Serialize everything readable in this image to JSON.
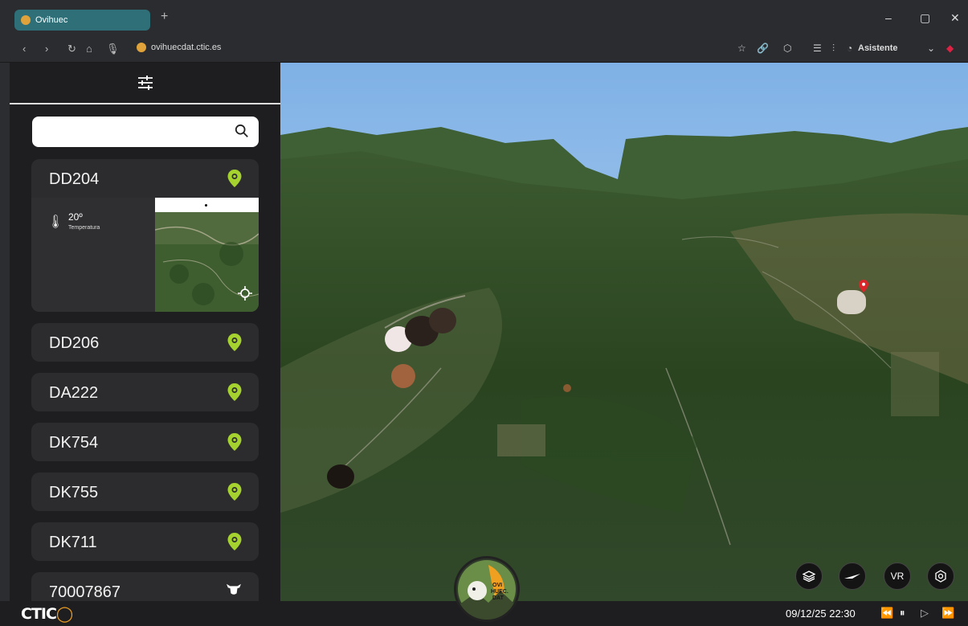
{
  "browser": {
    "tab_title": "Ovihuec",
    "new_tab": "+",
    "url": "ovihuecdat.ctic.es",
    "assistant_label": "Asistente"
  },
  "sidebar": {
    "search_placeholder": "",
    "animals": [
      {
        "id": "DD204",
        "icon": "location-pin-icon",
        "expanded": true,
        "temperature_value": "20º",
        "temperature_label": "Temperatura"
      },
      {
        "id": "DD206",
        "icon": "location-pin-icon"
      },
      {
        "id": "DA222",
        "icon": "location-pin-icon"
      },
      {
        "id": "DK754",
        "icon": "location-pin-icon"
      },
      {
        "id": "DK755",
        "icon": "location-pin-icon"
      },
      {
        "id": "DK711",
        "icon": "location-pin-icon"
      },
      {
        "id": "70007867",
        "icon": "cow-head-icon"
      }
    ]
  },
  "map_controls": {
    "vr_label": "VR"
  },
  "footer": {
    "logo_text": "CTIC",
    "datetime": "09/12/25 22:30",
    "emblem_text_1": "OVI",
    "emblem_text_2": "HUEC.",
    "emblem_text_3": "DAT"
  },
  "colors": {
    "accent_green": "#a6d22f",
    "tab_active": "#2f6f78",
    "panel_bg": "#1e1e20",
    "card_bg": "#2c2c2e",
    "marker_red": "#d9262b"
  }
}
